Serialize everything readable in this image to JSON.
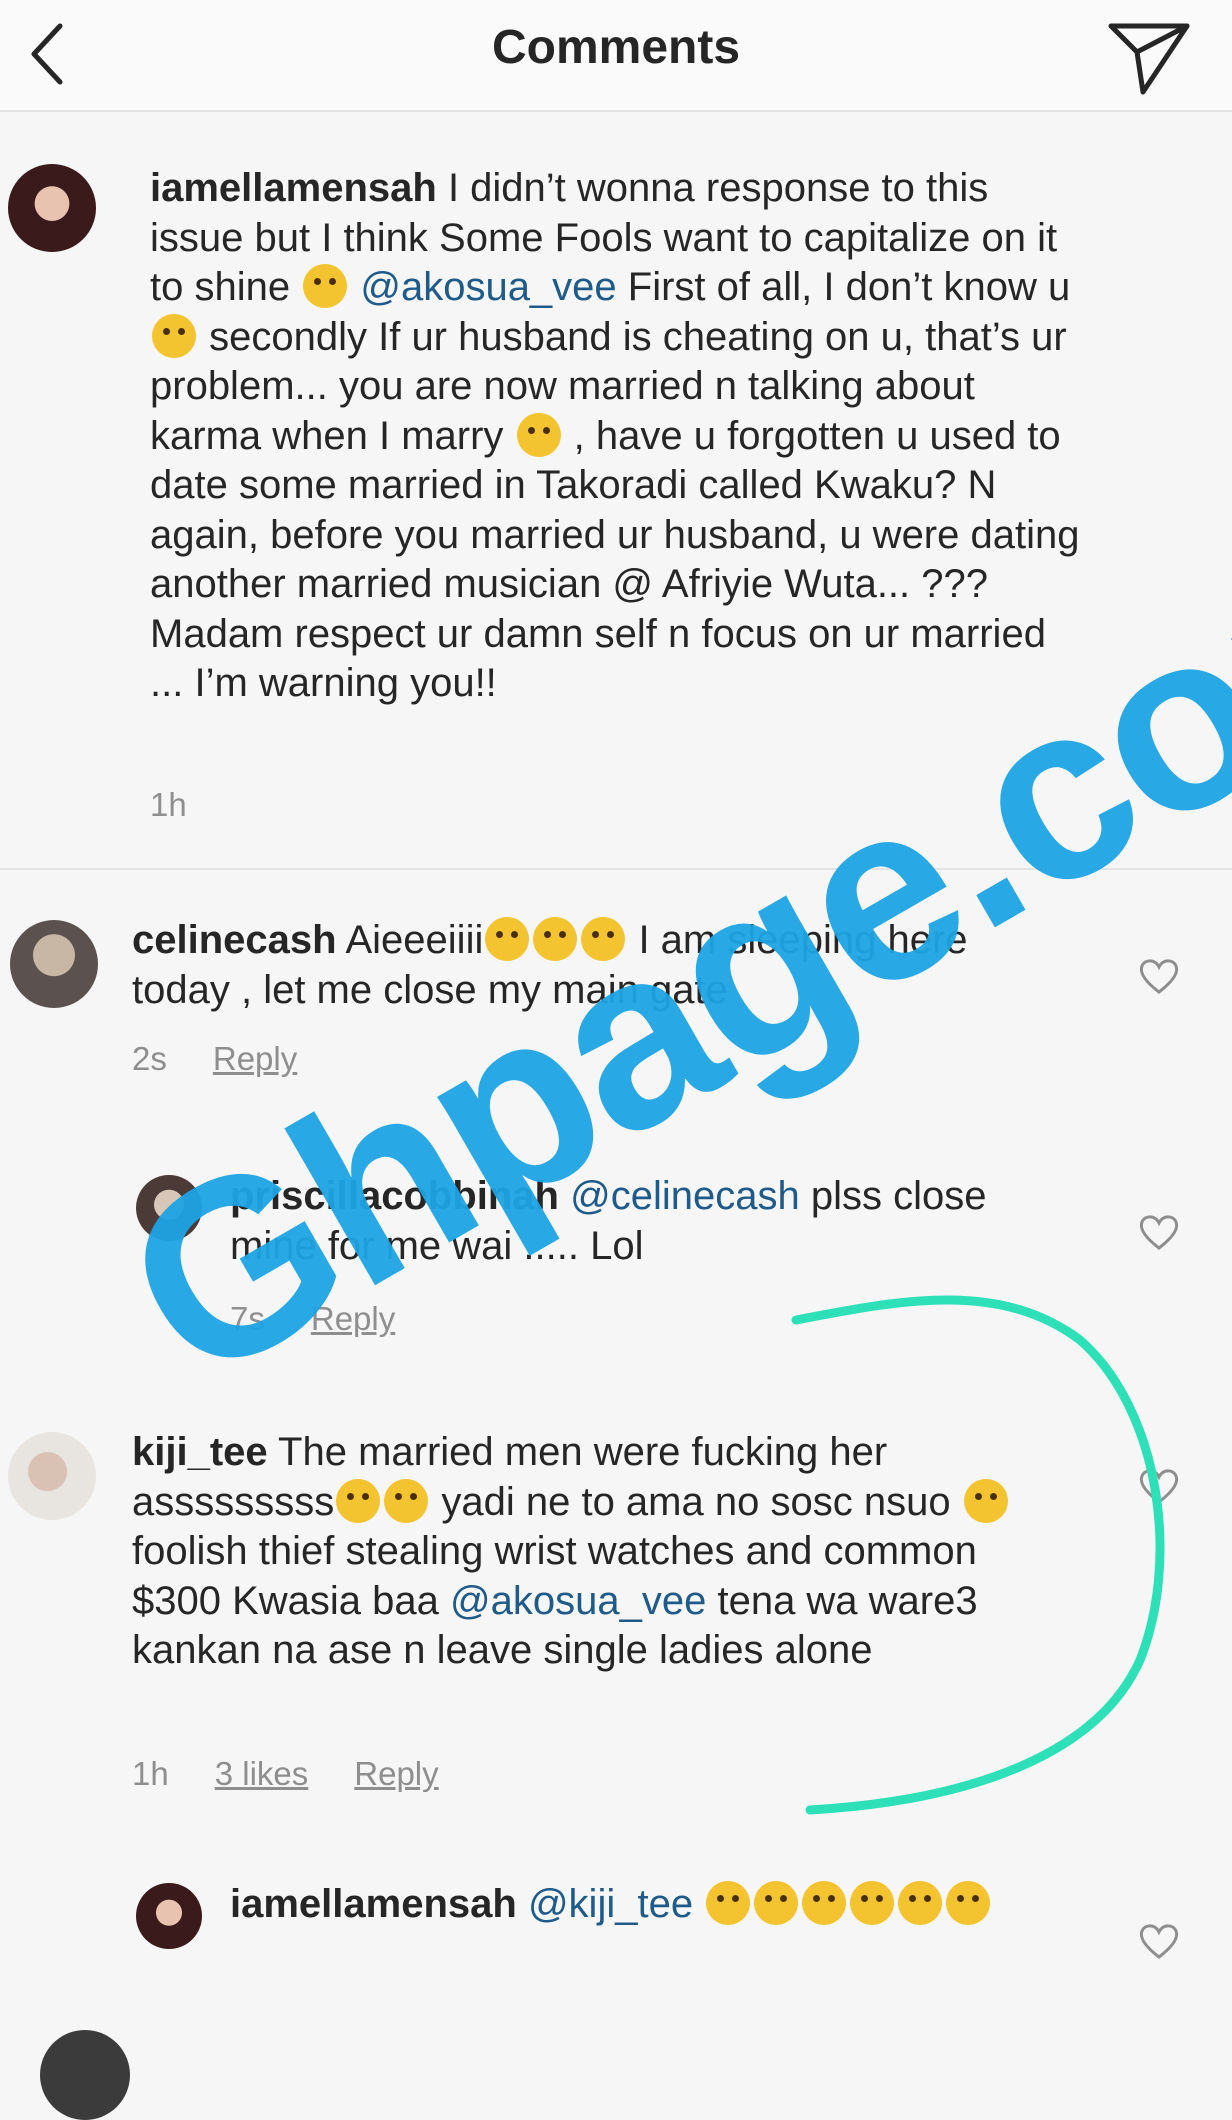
{
  "header": {
    "title": "Comments",
    "back_icon": "chevron-left-icon",
    "send_icon": "direct-send-icon"
  },
  "comments": [
    {
      "username": "iamellamensah",
      "text_1": " I didn’t wonna response to this issue but I think Some Fools want to capitalize on it to shine ",
      "mention_1": "@akosua_vee",
      "text_2": " First of all, I don’t know u",
      "text_3": " secondly If ur husband is cheating on u, that’s ur problem... you are now married n talking about karma when I marry ",
      "text_4": " , have u forgotten u used to date some married in Takoradi called Kwaku? N again, before you married ur husband, u were dating another married musician @ Afriyie Wuta... ??? Madam respect ur damn self n focus on ur married ... I’m warning you!!",
      "time": "1h"
    },
    {
      "username": "celinecash",
      "text_1": " Aieeeiiii",
      "text_2": " I am sleeping here today , let me close my main gate",
      "time": "2s",
      "reply": "Reply"
    },
    {
      "username": "priscillacobbinah",
      "mention_1": "@celinecash",
      "text_1": " plss close mine for me wai ..... Lol",
      "time": "7s",
      "reply": "Reply"
    },
    {
      "username": "kiji_tee",
      "text_1": " The married men were fucking her asssssssss",
      "text_2": " yadi ne to ama no sosc nsuo ",
      "text_3": " foolish thief stealing wrist watches and common $300 Kwasia baa ",
      "mention_1": "@akosua_vee",
      "text_4": " tena wa ware3 kankan na ase n leave single ladies alone",
      "time": "1h",
      "likes": "3 likes",
      "reply": "Reply"
    },
    {
      "username": "iamellamensah",
      "mention_1": "@kiji_tee",
      "text_1": " "
    }
  ],
  "watermark": "Ghpage.com",
  "colors": {
    "watermark": "#1da4e4",
    "annotation": "#2ee0b8",
    "mention": "#1e5a8a"
  }
}
